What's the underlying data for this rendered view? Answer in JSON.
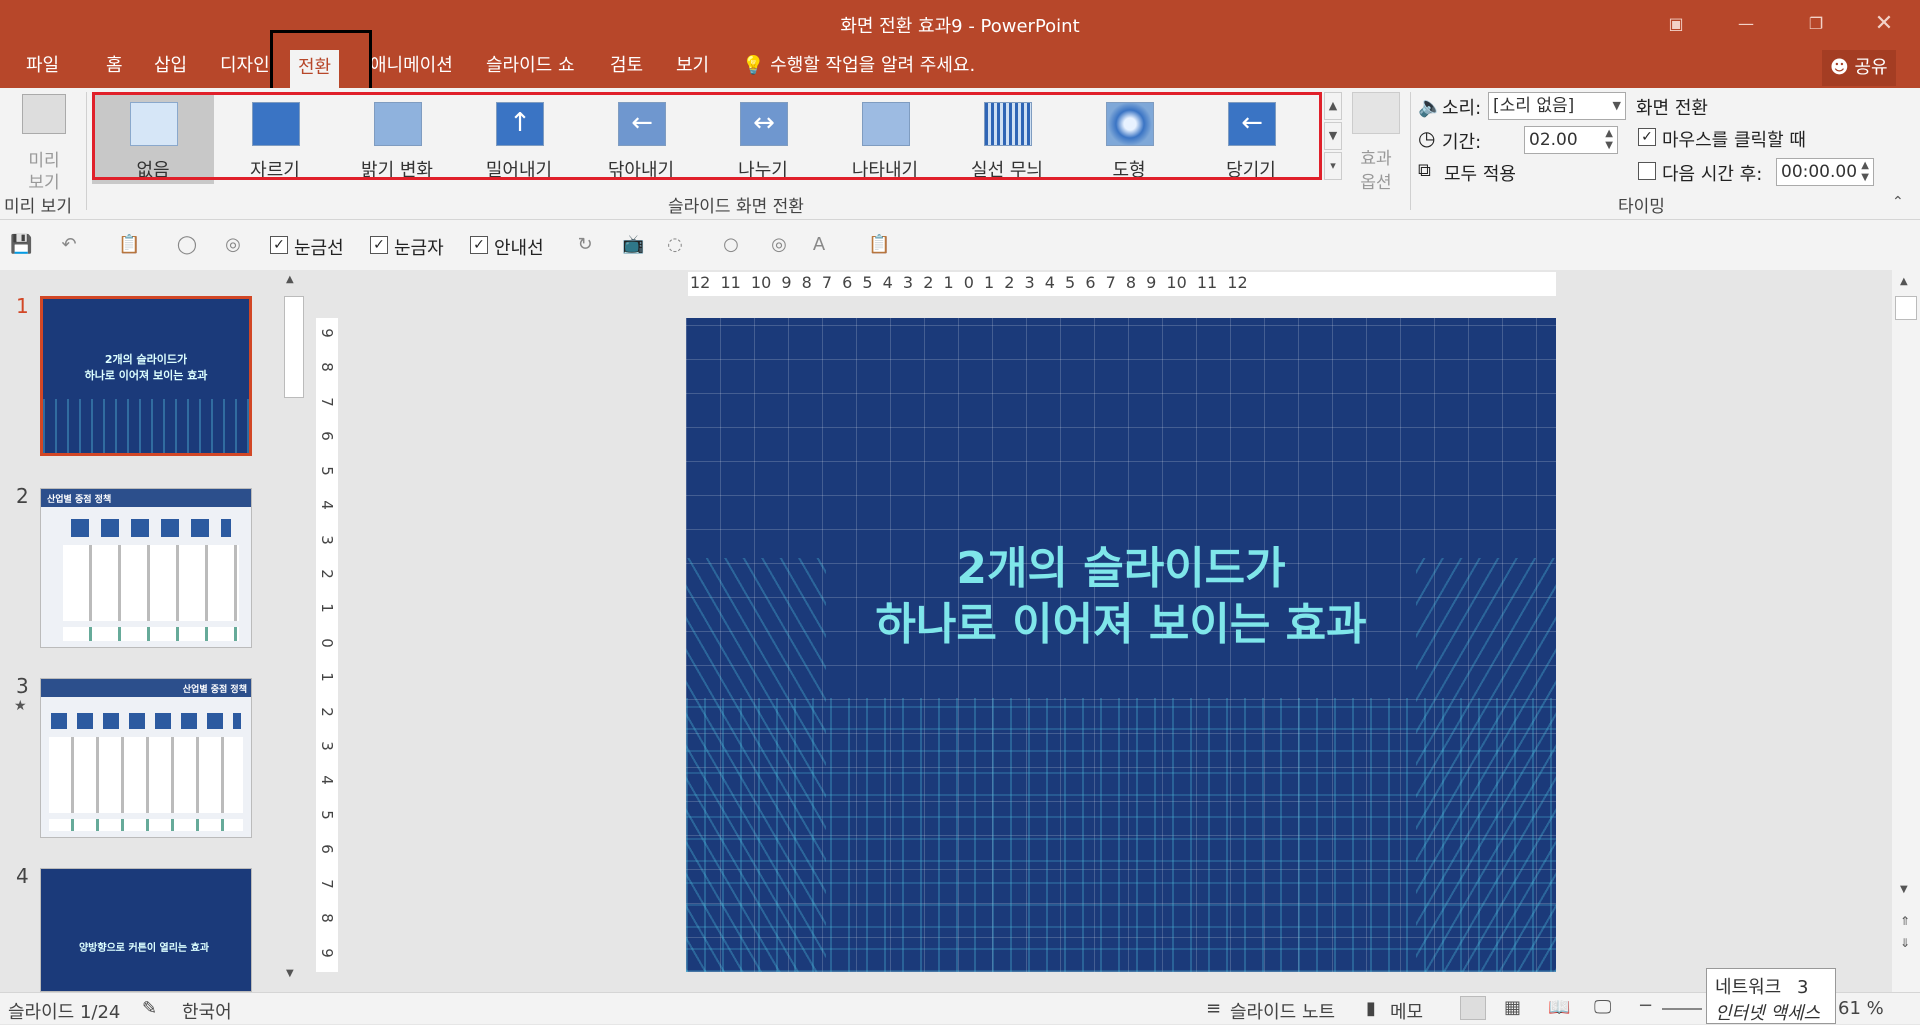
{
  "window": {
    "title": "화면 전환 효과9 - PowerPoint"
  },
  "tabs": [
    {
      "label": "파일"
    },
    {
      "label": "홈"
    },
    {
      "label": "삽입"
    },
    {
      "label": "디자인"
    },
    {
      "label": "전환"
    },
    {
      "label": "애니메이션"
    },
    {
      "label": "슬라이드 쇼"
    },
    {
      "label": "검토"
    },
    {
      "label": "보기"
    }
  ],
  "tell_me": "수행할 작업을 알려 주세요.",
  "share": "공유",
  "ribbon": {
    "preview": {
      "label1": "미리",
      "label2": "보기",
      "group": "미리 보기"
    },
    "transitions": [
      {
        "label": "없음"
      },
      {
        "label": "자르기"
      },
      {
        "label": "밝기 변화"
      },
      {
        "label": "밀어내기"
      },
      {
        "label": "닦아내기"
      },
      {
        "label": "나누기"
      },
      {
        "label": "나타내기"
      },
      {
        "label": "실선 무늬"
      },
      {
        "label": "도형"
      },
      {
        "label": "당기기"
      }
    ],
    "effect_options": {
      "label1": "효과",
      "label2": "옵션"
    },
    "transition_group": "슬라이드 화면 전환",
    "timing": {
      "sound_label": "소리:",
      "sound_value": "[소리 없음]",
      "duration_label": "기간:",
      "duration_value": "02.00",
      "apply_all": "모두 적용",
      "advance_title": "화면 전환",
      "on_click": "마우스를 클릭할 때",
      "after_label": "다음 시간 후:",
      "after_value": "00:00.00",
      "group": "타이밍"
    }
  },
  "qat": {
    "gridlines": "눈금선",
    "ruler": "눈금자",
    "guides": "안내선"
  },
  "slides": [
    {
      "num": "1",
      "line1": "2개의 슬라이드가",
      "line2": "하나로 이어져 보이는 효과"
    },
    {
      "num": "2",
      "header": "산업별 중점 정책"
    },
    {
      "num": "3",
      "header": "산업별 중점 정책"
    },
    {
      "num": "4",
      "line1": "양방향으로 커튼이 열리는 효과"
    }
  ],
  "main_slide": {
    "line1": "2개의 슬라이드가",
    "line2": "하나로 이어져 보이는 효과"
  },
  "hruler_text": "12 11 10 9 8 7 6 5 4 3 2 1 0 1 2 3 4 5 6 7 8 9 10 11 12",
  "vruler_labels": [
    "9",
    "8",
    "7",
    "6",
    "5",
    "4",
    "3",
    "2",
    "1",
    "0",
    "1",
    "2",
    "3",
    "4",
    "5",
    "6",
    "7",
    "8",
    "9"
  ],
  "status": {
    "slide_counter": "슬라이드 1/24",
    "language": "한국어",
    "notes": "슬라이드 노트",
    "comments": "메모",
    "zoom": "61 %"
  },
  "tooltip": {
    "line1": "네트워크",
    "count": "3",
    "line2": "인터넷 액세스"
  },
  "colors": {
    "accent": "#b7472a",
    "slide_bg": "#1b3a7a",
    "slide_text": "#7fe6ea",
    "highlight_red": "#e0202a"
  }
}
